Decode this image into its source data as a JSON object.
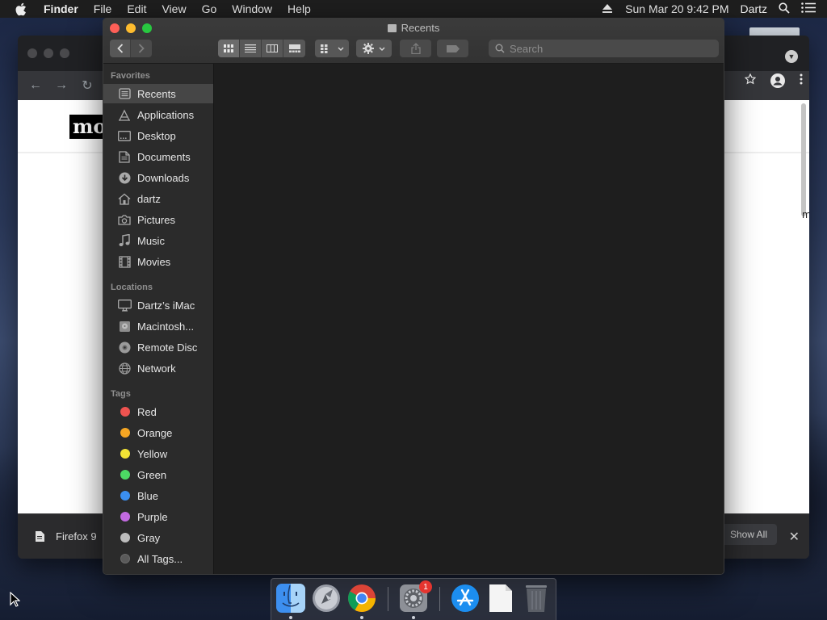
{
  "menubar": {
    "app_name": "Finder",
    "menus": [
      "File",
      "Edit",
      "View",
      "Go",
      "Window",
      "Help"
    ],
    "datetime": "Sun Mar 20  9:42 PM",
    "user": "Dartz"
  },
  "background_browser": {
    "page_logo_text": "mo",
    "edge_text": "m",
    "download_file": "Firefox 9",
    "show_all_label": "Show All"
  },
  "finder": {
    "window_title": "Recents",
    "search_placeholder": "Search",
    "sidebar": {
      "favorites_header": "Favorites",
      "favorites": [
        {
          "label": "Recents",
          "icon": "recents-icon",
          "selected": true
        },
        {
          "label": "Applications",
          "icon": "applications-icon"
        },
        {
          "label": "Desktop",
          "icon": "desktop-icon"
        },
        {
          "label": "Documents",
          "icon": "documents-icon"
        },
        {
          "label": "Downloads",
          "icon": "downloads-icon"
        },
        {
          "label": "dartz",
          "icon": "home-icon"
        },
        {
          "label": "Pictures",
          "icon": "camera-icon"
        },
        {
          "label": "Music",
          "icon": "music-note-icon"
        },
        {
          "label": "Movies",
          "icon": "film-icon"
        }
      ],
      "locations_header": "Locations",
      "locations": [
        {
          "label": "Dartz’s iMac",
          "icon": "imac-icon"
        },
        {
          "label": "Macintosh...",
          "icon": "hard-drive-icon"
        },
        {
          "label": "Remote Disc",
          "icon": "disc-icon"
        },
        {
          "label": "Network",
          "icon": "globe-icon"
        }
      ],
      "tags_header": "Tags",
      "tags": [
        {
          "label": "Red",
          "color": "#ef5350"
        },
        {
          "label": "Orange",
          "color": "#f5a623"
        },
        {
          "label": "Yellow",
          "color": "#f2e335"
        },
        {
          "label": "Green",
          "color": "#4cd964"
        },
        {
          "label": "Blue",
          "color": "#3b8ff0"
        },
        {
          "label": "Purple",
          "color": "#c26ae0"
        },
        {
          "label": "Gray",
          "color": "#bdbdbd"
        },
        {
          "label": "All Tags...",
          "color": "all"
        }
      ]
    }
  },
  "dock": {
    "items": [
      {
        "name": "finder-icon",
        "running": true
      },
      {
        "name": "launchpad-icon",
        "running": false
      },
      {
        "name": "chrome-icon",
        "running": true
      },
      {
        "name": "system-preferences-icon",
        "running": true,
        "badge": "1"
      },
      {
        "name": "app-store-icon",
        "running": false
      },
      {
        "name": "document-icon",
        "running": false
      },
      {
        "name": "trash-icon",
        "running": false
      }
    ]
  },
  "colors": {
    "close": "#fe5f57",
    "minimize": "#febc2e",
    "zoom": "#28c840"
  }
}
